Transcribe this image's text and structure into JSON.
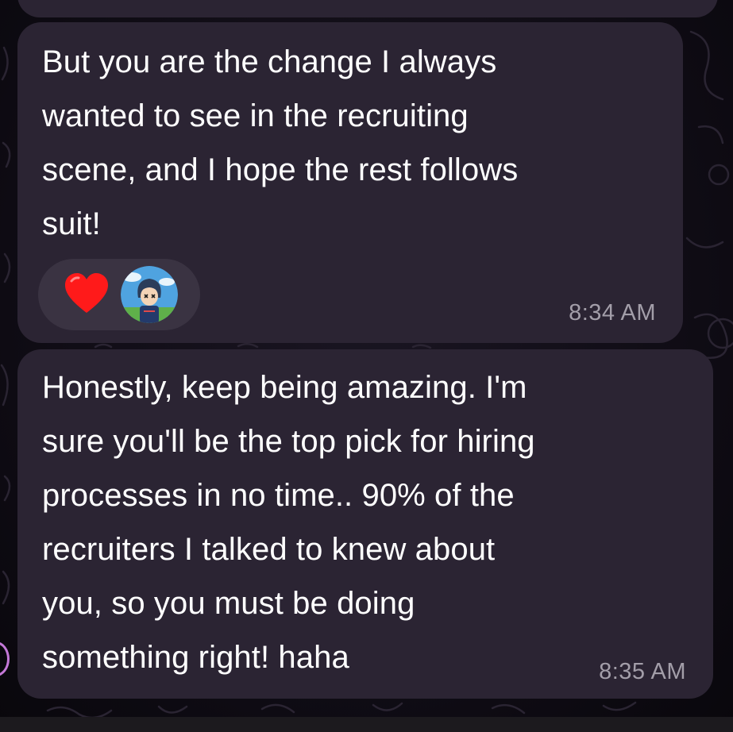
{
  "chat": {
    "messages": [
      {
        "text": "But you are the change I always\nwanted to see in the recruiting\nscene, and I hope the rest follows\nsuit!",
        "time": "8:34 AM",
        "reactions": [
          {
            "icon": "heart-icon",
            "color": "#ff1a1a"
          },
          {
            "icon": "avatar-reaction"
          }
        ]
      },
      {
        "text": "Honestly, keep being amazing. I'm\nsure you'll be the top pick for hiring\nprocesses in no time.. 90% of the\nrecruiters I talked to knew about\nyou, so you must be doing\nsomething right! haha",
        "time": "8:35 AM"
      }
    ]
  },
  "colors": {
    "background": "#0d0b12",
    "bubble": "#2b2433",
    "reaction_pill": "#3a3342",
    "text": "#ffffff",
    "timestamp": "#a39ea9",
    "heart": "#ff1a1a"
  }
}
